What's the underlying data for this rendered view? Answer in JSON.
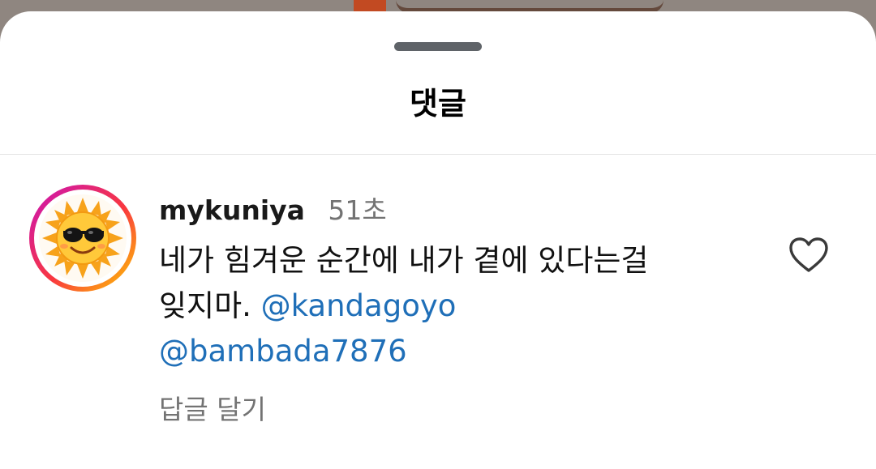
{
  "sheet": {
    "title": "댓글"
  },
  "comment": {
    "username": "mykuniya",
    "time": "51초",
    "text_line1": "네가 힘겨운 순간에 내가 곁에 있다는걸",
    "text_line2": "잊지마.",
    "mention1": "@kandagoyo",
    "mention2": "@bambada7876",
    "reply_label": "답글 달기",
    "avatar_icon": "sun-with-sunglasses",
    "like_icon": "heart-outline-icon"
  },
  "colors": {
    "mention": "#1f6fb8",
    "muted_text": "#737373",
    "story_ring_start": "#c913b9",
    "story_ring_end": "#fecd00"
  }
}
